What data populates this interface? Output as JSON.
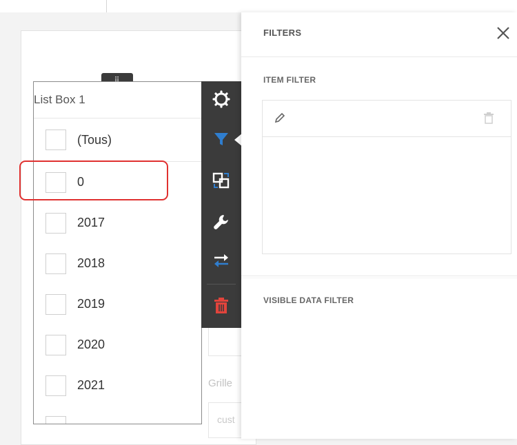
{
  "listbox": {
    "title": "List Box 1",
    "items": [
      {
        "label": "(Tous)"
      },
      {
        "label": "0"
      },
      {
        "label": "2017"
      },
      {
        "label": "2018"
      },
      {
        "label": "2019"
      },
      {
        "label": "2020"
      },
      {
        "label": "2021"
      }
    ]
  },
  "drag_handle": {
    "glyph": "⠿"
  },
  "background": {
    "grid_label": "Grille",
    "custom_text": "cust"
  },
  "toolbar": {
    "buttons": [
      "gear-icon",
      "filter-icon",
      "convert-icon",
      "wrench-icon",
      "interactivity-icon",
      "trash-icon"
    ],
    "active": "filter-icon",
    "icon_color": "#ffffff",
    "active_color": "#2f7ecf",
    "delete_color": "#e2443c"
  },
  "panel": {
    "title": "FILTERS",
    "item_filter_label": "ITEM FILTER",
    "visible_data_filter_label": "VISIBLE DATA FILTER"
  },
  "colors": {
    "highlight": "#e0302f",
    "toolbar_bg": "#3b3b3b"
  }
}
